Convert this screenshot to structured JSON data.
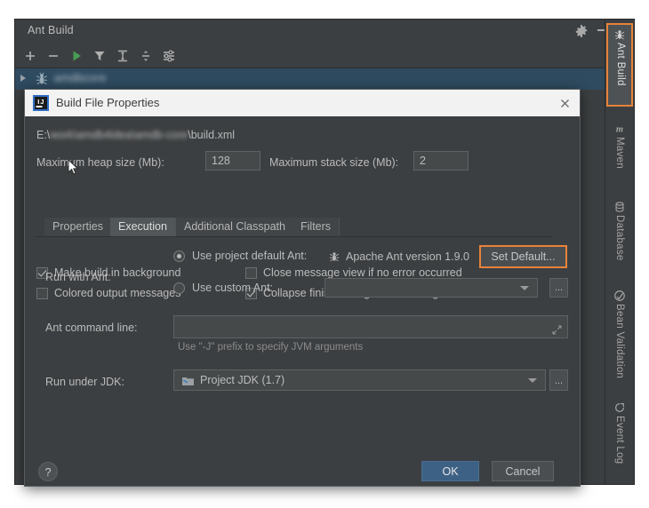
{
  "toolwindow": {
    "title": "Ant Build",
    "gear_icon": "gear-icon",
    "minimize_icon": "minimize-icon",
    "toolbar": [
      {
        "name": "add-button",
        "icon": "plus-icon",
        "label": "+"
      },
      {
        "name": "remove-button",
        "icon": "minus-icon",
        "label": "−"
      },
      {
        "name": "run-button",
        "icon": "play-icon",
        "label": "▶"
      },
      {
        "name": "filter-button",
        "icon": "filter-funnel-icon",
        "label": "filter"
      },
      {
        "name": "expand-all-button",
        "icon": "expand-all-icon",
        "label": "expand"
      },
      {
        "name": "collapse-all-button",
        "icon": "collapse-all-icon",
        "label": "collapse"
      },
      {
        "name": "properties-button",
        "icon": "sliders-icon",
        "label": "settings"
      }
    ],
    "tree": {
      "expand_arrow": "triangle-right-icon",
      "node_icon": "ant-bug-icon",
      "node_label": "amdbcore"
    }
  },
  "stripe": {
    "tabs": [
      {
        "label": "Ant Build",
        "icon": "ant-bug-icon",
        "selected": true
      },
      {
        "label": "Maven",
        "icon": "maven-m-icon",
        "selected": false
      },
      {
        "label": "Database",
        "icon": "database-icon",
        "selected": false
      },
      {
        "label": "Bean Validation",
        "icon": "bean-validation-icon",
        "selected": false
      },
      {
        "label": "Event Log",
        "icon": "event-log-icon",
        "selected": false
      }
    ]
  },
  "dialog": {
    "title": "Build File Properties",
    "title_icon": "intellij-idea-icon",
    "close_icon": "close-icon",
    "path": {
      "prefix": "E:\\",
      "redacted": "work\\amdb4idea\\amdb-core",
      "suffix": "\\build.xml"
    },
    "heap": {
      "label": "Maximum heap size (Mb):",
      "value": "128"
    },
    "stack": {
      "label": "Maximum stack size (Mb):",
      "value": "2"
    },
    "checkboxes": [
      {
        "name": "make-build-in-background-checkbox",
        "label": "Make build in background",
        "checked": true
      },
      {
        "name": "close-message-view-checkbox",
        "label": "Close message view if no error occurred",
        "checked": false
      },
      {
        "name": "colored-output-messages-checkbox",
        "label": "Colored output messages",
        "checked": false
      },
      {
        "name": "collapse-finished-targets-checkbox",
        "label": "Collapse finished targets in message view",
        "checked": true
      }
    ],
    "tabs": [
      {
        "label": "Properties",
        "selected": false
      },
      {
        "label": "Execution",
        "selected": true
      },
      {
        "label": "Additional Classpath",
        "selected": false
      },
      {
        "label": "Filters",
        "selected": false
      }
    ],
    "execution": {
      "run_with_ant_label": "Run with Ant:",
      "use_project_default_label": "Use project default Ant:",
      "use_project_default_selected": true,
      "ant_version_icon": "ant-bug-icon",
      "ant_version_text": "Apache Ant version 1.9.0",
      "set_default_button": "Set Default...",
      "use_custom_label": "Use custom Ant:",
      "use_custom_selected": false,
      "custom_ant_value": "",
      "browse_button": "...",
      "command_line_label": "Ant command line:",
      "command_line_value": "",
      "command_line_expand_icon": "expand-editor-icon",
      "command_line_hint": "Use \"-J\" prefix to specify JVM arguments",
      "jdk_label": "Run under JDK:",
      "jdk_value": "Project JDK (1.7)",
      "jdk_icon": "jdk-folder-icon",
      "jdk_browse_button": "..."
    },
    "footer": {
      "help_label": "?",
      "ok_label": "OK",
      "cancel_label": "Cancel"
    }
  },
  "colors": {
    "background": "#3c3f41",
    "accent_orange": "#e8833a",
    "ok_blue": "#3d6185",
    "run_green": "#499c54",
    "selection_blue": "#2f4b60",
    "title_bar": "#f2f2f2"
  }
}
